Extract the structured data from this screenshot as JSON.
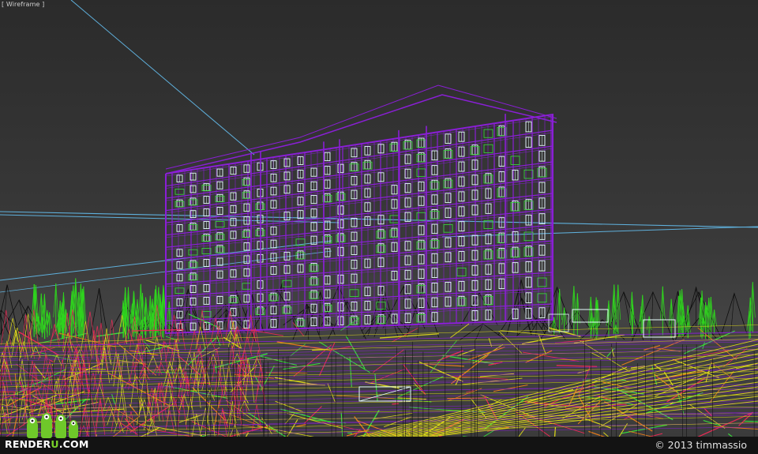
{
  "viewport": {
    "label": "[ Wireframe ]"
  },
  "watermark": {
    "logo_main": "RENDER",
    "logo_accent": "U",
    "logo_suffix": ".COM"
  },
  "footer": {
    "copyright": "© 2013 timmassio"
  },
  "colors": {
    "building": "#8a1fd6",
    "windows": "#e8ffff",
    "balcony_green": "#37e03a",
    "trees_green": "#2fd41e",
    "ground_yellow": "#d6d21a",
    "ground_red": "#e82a55",
    "ground_orange": "#e37a1a",
    "cyan_line": "#5fb0dc",
    "dark_lines": "#111111"
  },
  "icons": [
    "monster-mascot-icon"
  ]
}
